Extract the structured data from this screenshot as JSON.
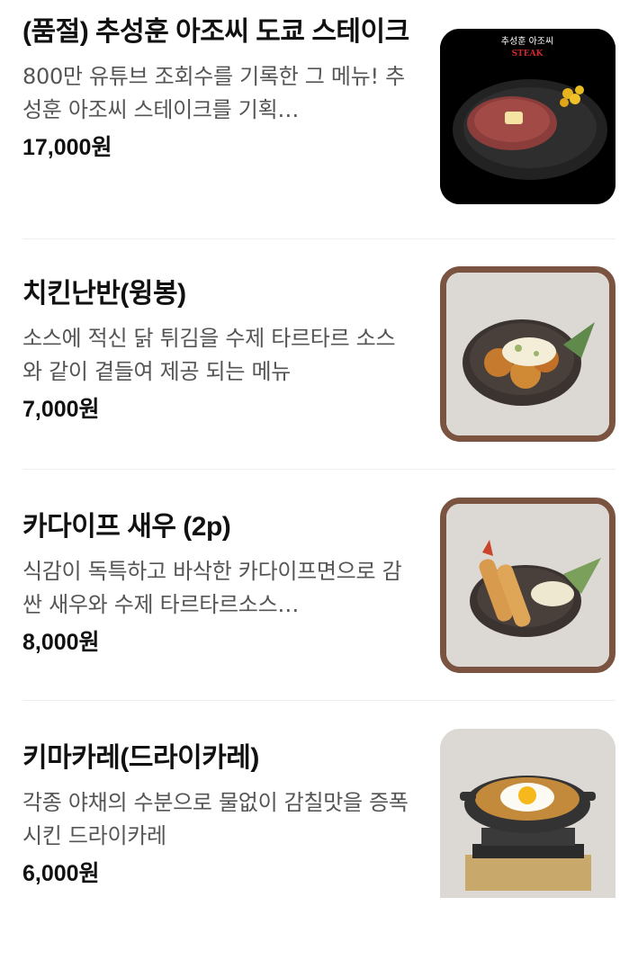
{
  "menu": {
    "items": [
      {
        "name": "(품절) 추성훈 아조씨 도쿄 스테이크",
        "description": "800만 유튜브 조회수를 기록한 그 메뉴! 추성훈 아조씨 스테이크를 기획…",
        "price": "17,000원",
        "image": {
          "caption_top": "추성훈 아조씨",
          "caption_sub": "STEAK",
          "icon": "steak-dish-photo"
        }
      },
      {
        "name": "치킨난반(윙봉)",
        "description": "소스에 적신 닭 튀김을 수제 타르타르 소스와 같이 곁들여 제공 되는 메뉴",
        "price": "7,000원",
        "image": {
          "icon": "chicken-nanban-photo"
        }
      },
      {
        "name": "카다이프 새우 (2p)",
        "description": "식감이 독특하고 바삭한 카다이프면으로 감싼 새우와 수제 타르타르소스…",
        "price": "8,000원",
        "image": {
          "icon": "kadaif-shrimp-photo"
        }
      },
      {
        "name": "키마카레(드라이카레)",
        "description": "각종 야채의 수분으로 물없이 감칠맛을 증폭시킨 드라이카레",
        "price": "6,000원",
        "image": {
          "icon": "keema-curry-photo"
        }
      }
    ]
  },
  "colors": {
    "frame_brown": "#7a5440",
    "text_primary": "#111111",
    "text_secondary": "#555555",
    "divider": "#eeeeee"
  }
}
